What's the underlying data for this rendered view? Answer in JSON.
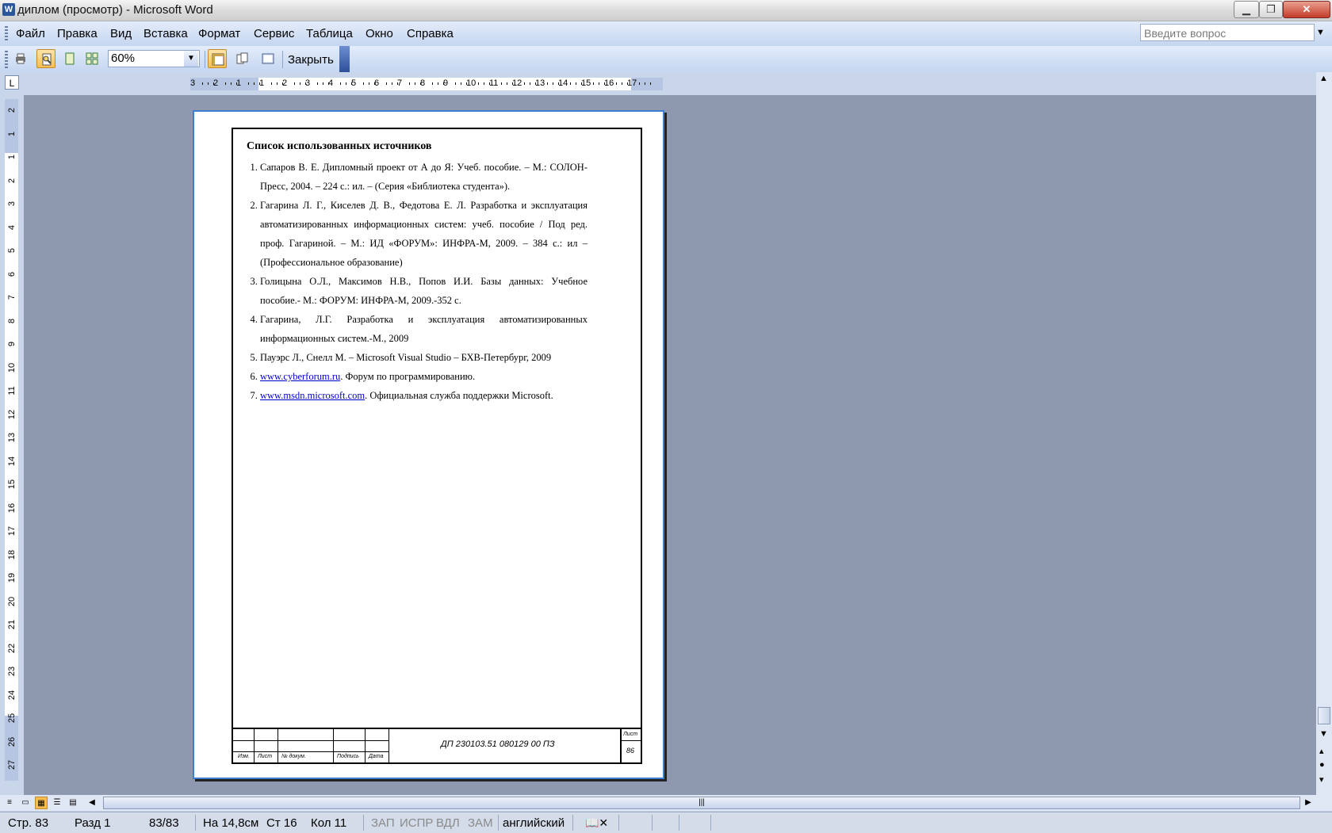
{
  "window": {
    "title": "диплом (просмотр) - Microsoft Word"
  },
  "menu": [
    "Файл",
    "Правка",
    "Вид",
    "Вставка",
    "Формат",
    "Сервис",
    "Таблица",
    "Окно",
    "Справка"
  ],
  "help_box": {
    "placeholder": "Введите вопрос"
  },
  "toolbar": {
    "zoom": "60%",
    "close_label": "Закрыть"
  },
  "ruler": {
    "h_ticks": [
      "3",
      "2",
      "1",
      "1",
      "2",
      "3",
      "4",
      "5",
      "6",
      "7",
      "8",
      "9",
      "10",
      "11",
      "12",
      "13",
      "14",
      "15",
      "16",
      "17"
    ],
    "v_ticks": [
      "2",
      "1",
      "1",
      "2",
      "3",
      "4",
      "5",
      "6",
      "7",
      "8",
      "9",
      "10",
      "11",
      "12",
      "13",
      "14",
      "15",
      "16",
      "17",
      "18",
      "19",
      "20",
      "21",
      "22",
      "23",
      "24",
      "25",
      "26",
      "27"
    ]
  },
  "document": {
    "heading": "Список использованных источников",
    "items": [
      {
        "text": "Сапаров В. Е. Дипломный проект от А до Я: Учеб. пособие. – М.: СОЛОН-Пресс, 2004. – 224 с.: ил. – (Серия «Библиотека студента»)."
      },
      {
        "text": "Гагарина Л. Г., Киселев Д. В., Федотова Е. Л. Разработка и эксплуатация автоматизированных информационных систем: учеб. пособие / Под ред. проф. Гагариной. – М.: ИД «ФОРУМ»: ИНФРА-М, 2009. – 384 с.: ил – (Профессиональное образование)"
      },
      {
        "text": "Голицына О.Л., Максимов Н.В., Попов И.И. Базы данных: Учебное пособие.- М.: ФОРУМ: ИНФРА-М, 2009.-352 с."
      },
      {
        "text": "Гагарина, Л.Г. Разработка и эксплуатация автоматизированных информационных систем.-М., 2009"
      },
      {
        "text": "Пауэрс Л., Снелл М. – Microsoft Visual Studio – БХВ-Петербург, 2009"
      },
      {
        "link": "www.cyberforum.ru",
        "text": ". Форум по программированию."
      },
      {
        "link": "www.msdn.microsoft.com",
        "text": ". Официальная служба поддержки Microsoft."
      }
    ],
    "stamp": {
      "col_labels": [
        "Изм.",
        "Лист",
        "№ докум.",
        "Подпись",
        "Дата"
      ],
      "code": "ДП 230103.51 080129 00 ПЗ",
      "sheet_label": "Лист",
      "sheet_number": "86"
    }
  },
  "status": {
    "page": "Стр. 83",
    "section": "Разд 1",
    "pages": "83/83",
    "position": "На 14,8см",
    "line": "Ст 16",
    "column": "Кол 11",
    "rec": "ЗАП",
    "trk": "ИСПР",
    "ext": "ВДЛ",
    "ovr": "ЗАМ",
    "language": "английский"
  }
}
